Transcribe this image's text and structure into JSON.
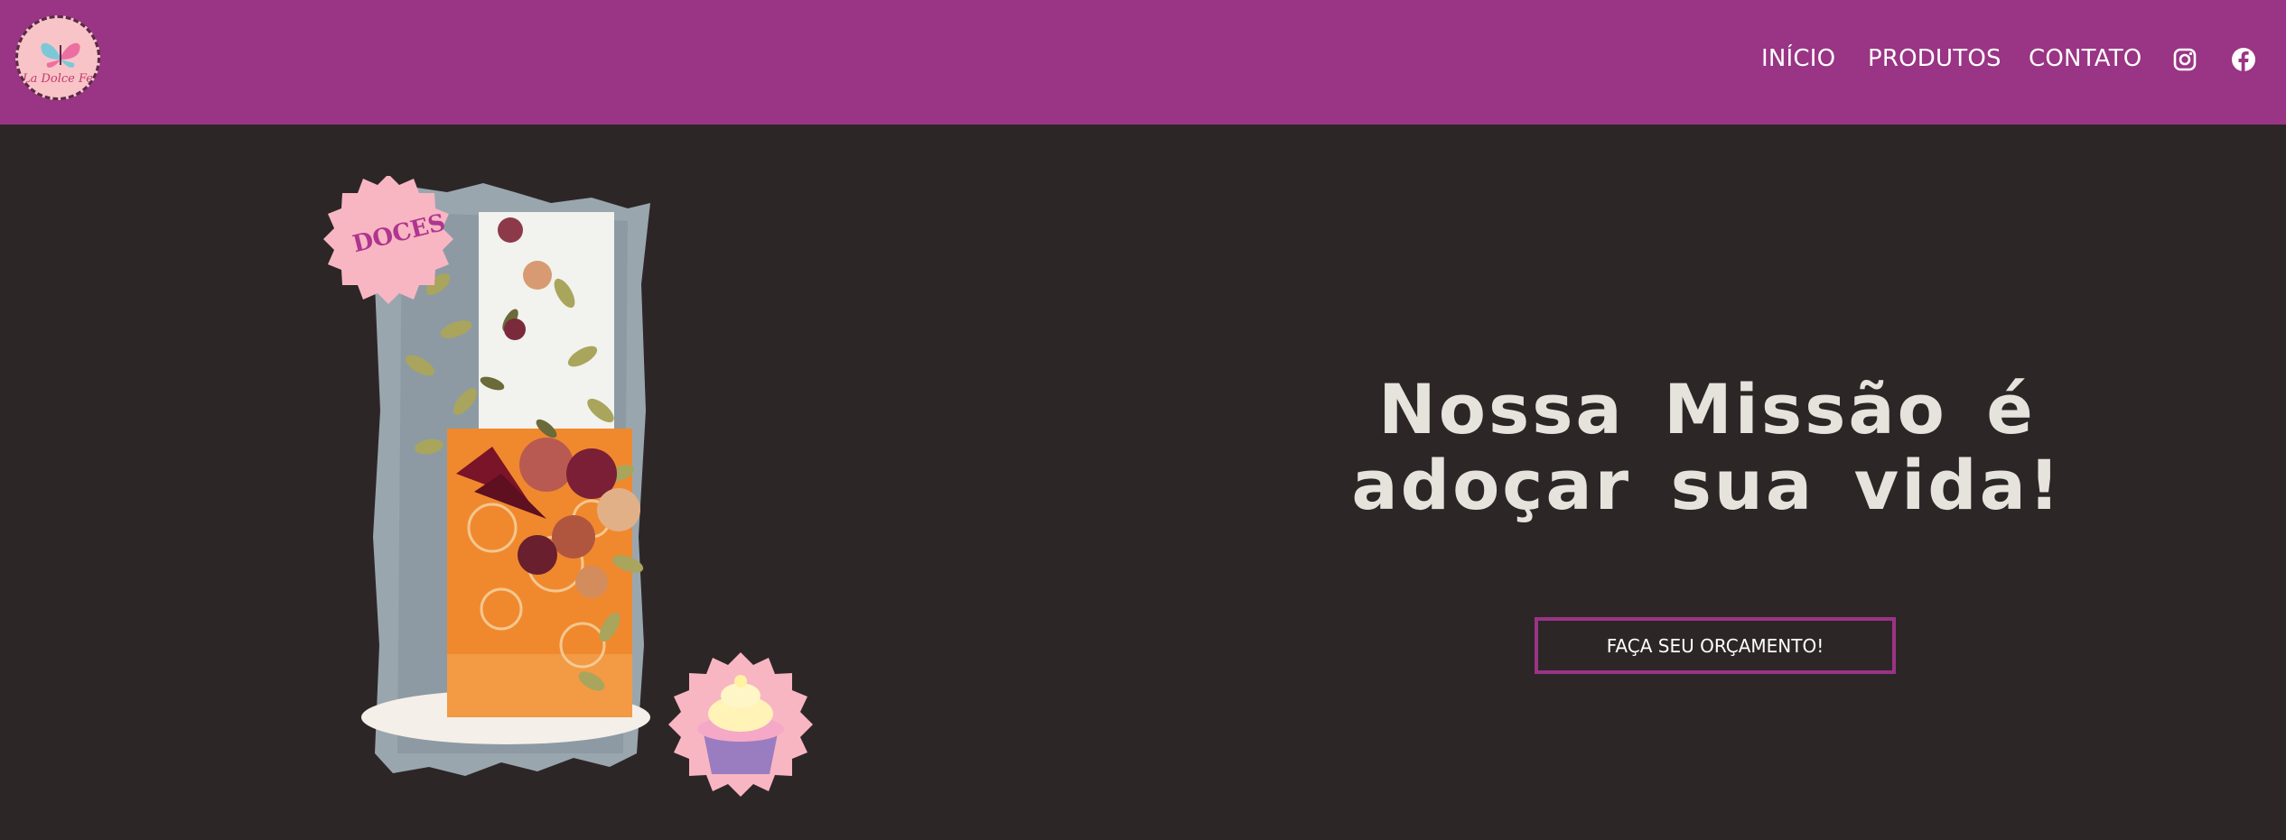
{
  "header": {
    "logo_text": "La Dolce Fe",
    "nav": [
      {
        "label": "INÍCIO"
      },
      {
        "label": "PRODUTOS"
      },
      {
        "label": "CONTATO"
      }
    ],
    "social_icons": [
      "instagram-icon",
      "facebook-icon"
    ],
    "background": "#9a3484"
  },
  "hero": {
    "badge_text": "DOCES",
    "title": "Nossa Missão é adoçar sua vida!",
    "cta_label": "FAÇA SEU ORÇAMENTO!",
    "background": "#2d2627",
    "accent": "#9a3484",
    "badge_color": "#f8b6c3"
  }
}
